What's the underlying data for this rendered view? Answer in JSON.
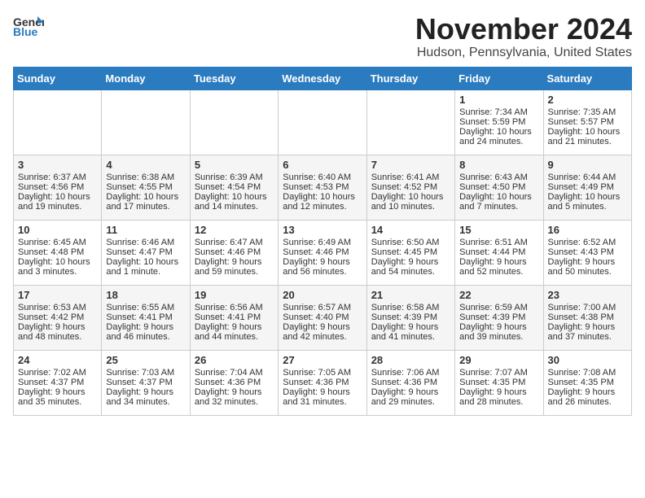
{
  "header": {
    "logo_line1": "General",
    "logo_line2": "Blue",
    "month": "November 2024",
    "location": "Hudson, Pennsylvania, United States"
  },
  "days_of_week": [
    "Sunday",
    "Monday",
    "Tuesday",
    "Wednesday",
    "Thursday",
    "Friday",
    "Saturday"
  ],
  "weeks": [
    [
      {
        "day": "",
        "info": ""
      },
      {
        "day": "",
        "info": ""
      },
      {
        "day": "",
        "info": ""
      },
      {
        "day": "",
        "info": ""
      },
      {
        "day": "",
        "info": ""
      },
      {
        "day": "1",
        "info": "Sunrise: 7:34 AM\nSunset: 5:59 PM\nDaylight: 10 hours and 24 minutes."
      },
      {
        "day": "2",
        "info": "Sunrise: 7:35 AM\nSunset: 5:57 PM\nDaylight: 10 hours and 21 minutes."
      }
    ],
    [
      {
        "day": "3",
        "info": "Sunrise: 6:37 AM\nSunset: 4:56 PM\nDaylight: 10 hours and 19 minutes."
      },
      {
        "day": "4",
        "info": "Sunrise: 6:38 AM\nSunset: 4:55 PM\nDaylight: 10 hours and 17 minutes."
      },
      {
        "day": "5",
        "info": "Sunrise: 6:39 AM\nSunset: 4:54 PM\nDaylight: 10 hours and 14 minutes."
      },
      {
        "day": "6",
        "info": "Sunrise: 6:40 AM\nSunset: 4:53 PM\nDaylight: 10 hours and 12 minutes."
      },
      {
        "day": "7",
        "info": "Sunrise: 6:41 AM\nSunset: 4:52 PM\nDaylight: 10 hours and 10 minutes."
      },
      {
        "day": "8",
        "info": "Sunrise: 6:43 AM\nSunset: 4:50 PM\nDaylight: 10 hours and 7 minutes."
      },
      {
        "day": "9",
        "info": "Sunrise: 6:44 AM\nSunset: 4:49 PM\nDaylight: 10 hours and 5 minutes."
      }
    ],
    [
      {
        "day": "10",
        "info": "Sunrise: 6:45 AM\nSunset: 4:48 PM\nDaylight: 10 hours and 3 minutes."
      },
      {
        "day": "11",
        "info": "Sunrise: 6:46 AM\nSunset: 4:47 PM\nDaylight: 10 hours and 1 minute."
      },
      {
        "day": "12",
        "info": "Sunrise: 6:47 AM\nSunset: 4:46 PM\nDaylight: 9 hours and 59 minutes."
      },
      {
        "day": "13",
        "info": "Sunrise: 6:49 AM\nSunset: 4:46 PM\nDaylight: 9 hours and 56 minutes."
      },
      {
        "day": "14",
        "info": "Sunrise: 6:50 AM\nSunset: 4:45 PM\nDaylight: 9 hours and 54 minutes."
      },
      {
        "day": "15",
        "info": "Sunrise: 6:51 AM\nSunset: 4:44 PM\nDaylight: 9 hours and 52 minutes."
      },
      {
        "day": "16",
        "info": "Sunrise: 6:52 AM\nSunset: 4:43 PM\nDaylight: 9 hours and 50 minutes."
      }
    ],
    [
      {
        "day": "17",
        "info": "Sunrise: 6:53 AM\nSunset: 4:42 PM\nDaylight: 9 hours and 48 minutes."
      },
      {
        "day": "18",
        "info": "Sunrise: 6:55 AM\nSunset: 4:41 PM\nDaylight: 9 hours and 46 minutes."
      },
      {
        "day": "19",
        "info": "Sunrise: 6:56 AM\nSunset: 4:41 PM\nDaylight: 9 hours and 44 minutes."
      },
      {
        "day": "20",
        "info": "Sunrise: 6:57 AM\nSunset: 4:40 PM\nDaylight: 9 hours and 42 minutes."
      },
      {
        "day": "21",
        "info": "Sunrise: 6:58 AM\nSunset: 4:39 PM\nDaylight: 9 hours and 41 minutes."
      },
      {
        "day": "22",
        "info": "Sunrise: 6:59 AM\nSunset: 4:39 PM\nDaylight: 9 hours and 39 minutes."
      },
      {
        "day": "23",
        "info": "Sunrise: 7:00 AM\nSunset: 4:38 PM\nDaylight: 9 hours and 37 minutes."
      }
    ],
    [
      {
        "day": "24",
        "info": "Sunrise: 7:02 AM\nSunset: 4:37 PM\nDaylight: 9 hours and 35 minutes."
      },
      {
        "day": "25",
        "info": "Sunrise: 7:03 AM\nSunset: 4:37 PM\nDaylight: 9 hours and 34 minutes."
      },
      {
        "day": "26",
        "info": "Sunrise: 7:04 AM\nSunset: 4:36 PM\nDaylight: 9 hours and 32 minutes."
      },
      {
        "day": "27",
        "info": "Sunrise: 7:05 AM\nSunset: 4:36 PM\nDaylight: 9 hours and 31 minutes."
      },
      {
        "day": "28",
        "info": "Sunrise: 7:06 AM\nSunset: 4:36 PM\nDaylight: 9 hours and 29 minutes."
      },
      {
        "day": "29",
        "info": "Sunrise: 7:07 AM\nSunset: 4:35 PM\nDaylight: 9 hours and 28 minutes."
      },
      {
        "day": "30",
        "info": "Sunrise: 7:08 AM\nSunset: 4:35 PM\nDaylight: 9 hours and 26 minutes."
      }
    ]
  ]
}
